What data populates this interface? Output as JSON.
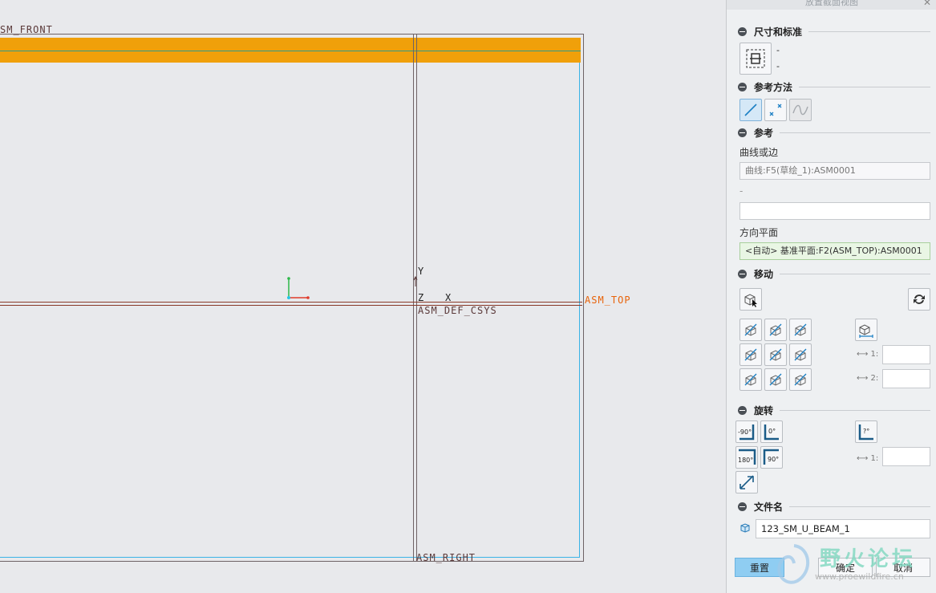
{
  "panel": {
    "title": "放置截面视图",
    "sections": {
      "size": "尺寸和标准",
      "method": "参考方法",
      "reference": "参考",
      "move": "移动",
      "rotate": "旋转",
      "filename": "文件名"
    },
    "size_values": [
      "-",
      "-"
    ],
    "curve_label": "曲线或边",
    "curve_value": "曲线:F5(草绘_1):ASM0001",
    "dash_label": "-",
    "dir_label": "方向平面",
    "dir_value": "<自动> 基准平面:F2(ASM_TOP):ASM0001",
    "dim1_label": "1:",
    "dim2_label": "2:",
    "dim3_label": "1:",
    "rotate_labels": {
      "neg90": "-90°",
      "zero": "0°",
      "custom": "?°",
      "r180": "180°",
      "r90": "90°"
    },
    "filename_value": "123_SM_U_BEAM_1",
    "buttons": {
      "reset": "重置",
      "ok": "确定",
      "cancel": "取消"
    }
  },
  "viewport": {
    "labels": {
      "front": "SM_FRONT",
      "top": "ASM_TOP",
      "csys": "ASM_DEF_CSYS",
      "right": "ASM_RIGHT",
      "axis_y": "Y",
      "axis_z": "Z",
      "axis_x": "X"
    }
  },
  "watermark": {
    "name": "野火论坛",
    "url": "www.proewildfire.cn"
  },
  "colors": {
    "beam": "#f0a00a",
    "datum_top": "#e8630a",
    "accent": "#1b7fc4"
  }
}
